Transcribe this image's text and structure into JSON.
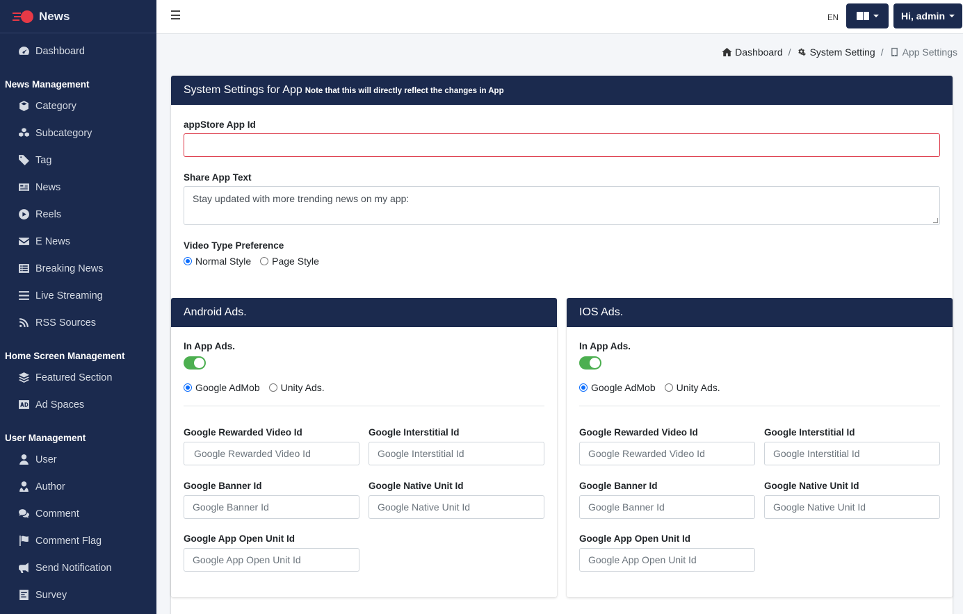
{
  "brand": {
    "name": "News"
  },
  "sidebar": {
    "dashboard": "Dashboard",
    "sections": [
      {
        "header": "News Management",
        "items": [
          "Category",
          "Subcategory",
          "Tag",
          "News",
          "Reels",
          "E News",
          "Breaking News",
          "Live Streaming",
          "RSS Sources"
        ]
      },
      {
        "header": "Home Screen Management",
        "items": [
          "Featured Section",
          "Ad Spaces"
        ]
      },
      {
        "header": "User Management",
        "items": [
          "User",
          "Author",
          "Comment",
          "Comment Flag",
          "Send Notification",
          "Survey"
        ]
      }
    ]
  },
  "topbar": {
    "lang_code": "EN",
    "user_label": "Hi, admin"
  },
  "breadcrumb": {
    "dashboard": "Dashboard",
    "system_setting": "System Setting",
    "app_settings": "App Settings"
  },
  "settings": {
    "title": "System Settings for App",
    "note": "Note that this will directly reflect the changes in App",
    "appstore_label": "appStore App Id",
    "appstore_value": "",
    "share_label": "Share App Text",
    "share_value": "Stay updated with more trending news on my app:",
    "video_pref_label": "Video Type Preference",
    "video_options": [
      "Normal Style",
      "Page Style"
    ],
    "video_selected": "Normal Style"
  },
  "android": {
    "title": "Android Ads.",
    "in_app_label": "In App Ads.",
    "in_app_enabled": true,
    "providers": [
      "Google AdMob",
      "Unity Ads."
    ],
    "provider_selected": "Google AdMob",
    "rewarded_label": "Google Rewarded Video Id",
    "rewarded_ph": "Google Rewarded Video Id",
    "interstitial_label": "Google Interstitial Id",
    "interstitial_ph": "Google Interstitial Id",
    "banner_label": "Google Banner Id",
    "banner_ph": "Google Banner Id",
    "native_label": "Google Native Unit Id",
    "native_ph": "Google Native Unit Id",
    "open_label": "Google App Open Unit Id",
    "open_ph": "Google App Open Unit Id"
  },
  "ios": {
    "title": "IOS Ads.",
    "in_app_label": "In App Ads.",
    "in_app_enabled": true,
    "providers": [
      "Google AdMob",
      "Unity Ads."
    ],
    "provider_selected": "Google AdMob",
    "rewarded_label": "Google Rewarded Video Id",
    "rewarded_ph": "Google Rewarded Video Id",
    "interstitial_label": "Google Interstitial Id",
    "interstitial_ph": "Google Interstitial Id",
    "banner_label": "Google Banner Id",
    "banner_ph": "Google Banner Id",
    "native_label": "Google Native Unit Id",
    "native_ph": "Google Native Unit Id",
    "open_label": "Google App Open Unit Id",
    "open_ph": "Google App Open Unit Id"
  }
}
